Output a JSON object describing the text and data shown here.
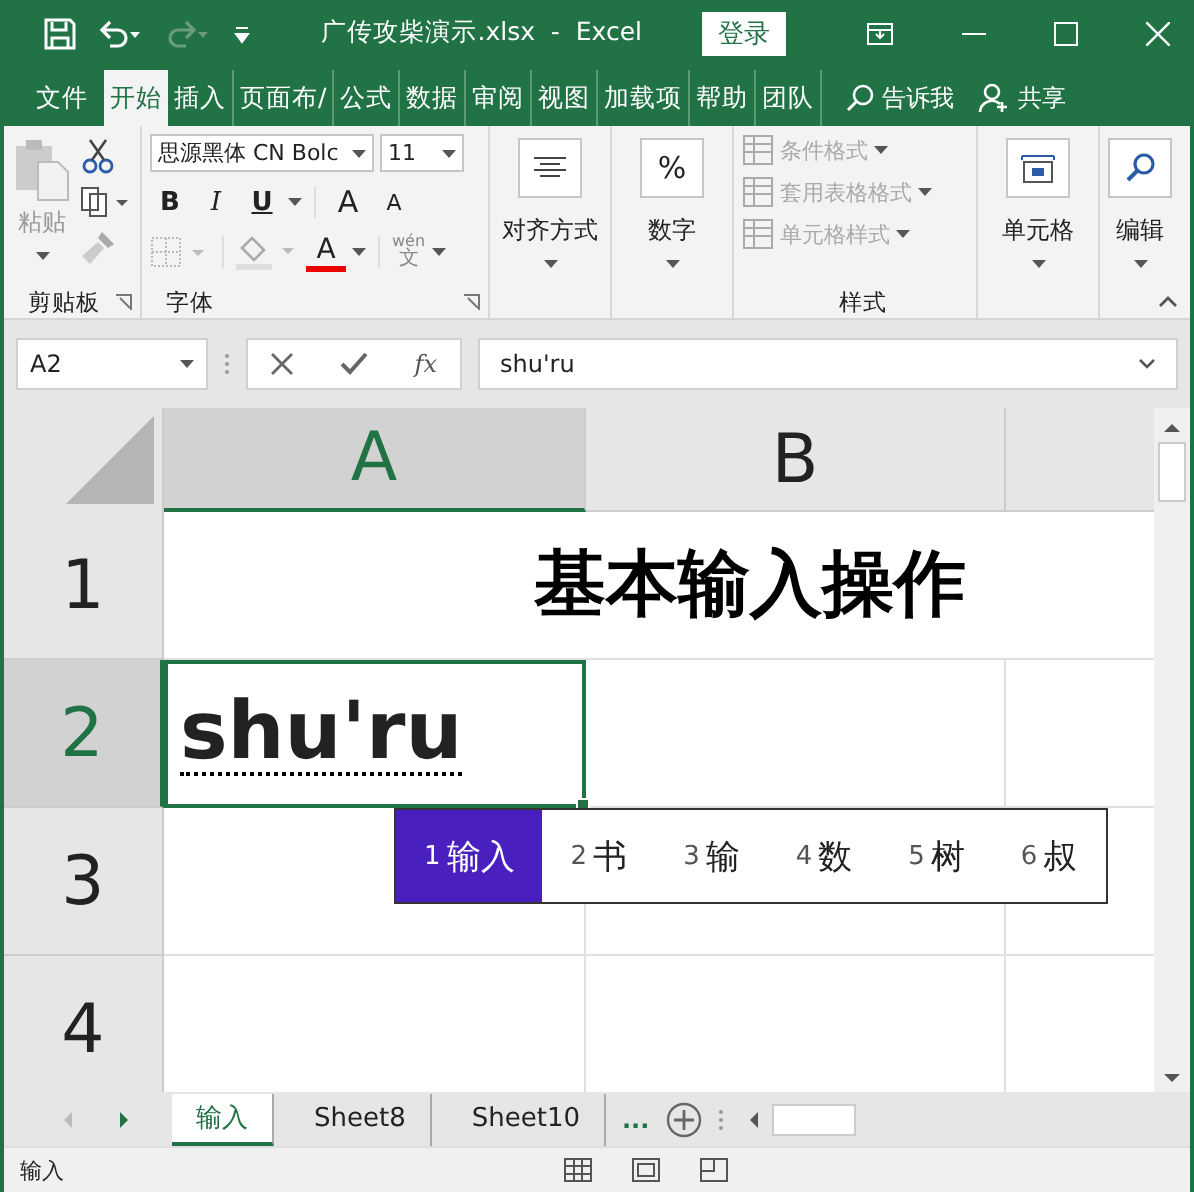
{
  "window": {
    "title": "广传攻柴演示.xlsx  -  Excel",
    "login": "登录"
  },
  "ribbon_tabs": [
    {
      "label": "文件",
      "selected": false
    },
    {
      "label": "开始",
      "selected": true
    },
    {
      "label": "插入",
      "selected": false
    },
    {
      "label": "页面布/",
      "selected": false
    },
    {
      "label": "公式",
      "selected": false
    },
    {
      "label": "数据",
      "selected": false
    },
    {
      "label": "审阅",
      "selected": false
    },
    {
      "label": "视图",
      "selected": false
    },
    {
      "label": "加载项",
      "selected": false
    },
    {
      "label": "帮助",
      "selected": false
    },
    {
      "label": "团队",
      "selected": false
    }
  ],
  "tell_me": "告诉我",
  "share": "共享",
  "clipboard": {
    "paste": "粘贴",
    "label": "剪贴板"
  },
  "font": {
    "name": "思源黑体 CN Bolc",
    "size": "11",
    "bold": "B",
    "italic": "I",
    "underline": "U",
    "grow": "A",
    "shrink": "A",
    "color_glyph": "A",
    "phonetic_top": "wén",
    "phonetic_bottom": "文",
    "label": "字体"
  },
  "alignment": {
    "label": "对齐方式"
  },
  "number": {
    "glyph": "%",
    "label": "数字"
  },
  "styles": {
    "items": [
      {
        "label": "条件格式"
      },
      {
        "label": "套用表格格式"
      },
      {
        "label": "单元格样式"
      }
    ],
    "label": "样式"
  },
  "cells_group": {
    "label": "单元格"
  },
  "editing": {
    "label": "编辑"
  },
  "name_box": "A2",
  "fx": "fx",
  "formula": "shu'ru",
  "columns": [
    {
      "label": "A",
      "selected": true
    },
    {
      "label": "B",
      "selected": false
    }
  ],
  "rows": [
    {
      "label": "1",
      "selected": false
    },
    {
      "label": "2",
      "selected": true
    },
    {
      "label": "3",
      "selected": false
    },
    {
      "label": "4",
      "selected": false
    }
  ],
  "title_cell": "基本输入操作",
  "active_cell": "shu'ru",
  "ime": {
    "candidates": [
      {
        "index": "1",
        "text": "输入",
        "selected": true
      },
      {
        "index": "2",
        "text": "书",
        "selected": false
      },
      {
        "index": "3",
        "text": "输",
        "selected": false
      },
      {
        "index": "4",
        "text": "数",
        "selected": false
      },
      {
        "index": "5",
        "text": "树",
        "selected": false
      },
      {
        "index": "6",
        "text": "叔",
        "selected": false
      }
    ]
  },
  "sheet_tabs": [
    {
      "label": "输入",
      "selected": true
    },
    {
      "label": "Sheet8",
      "selected": false
    },
    {
      "label": "Sheet10",
      "selected": false
    }
  ],
  "more_sheets": "...",
  "status": "输入"
}
